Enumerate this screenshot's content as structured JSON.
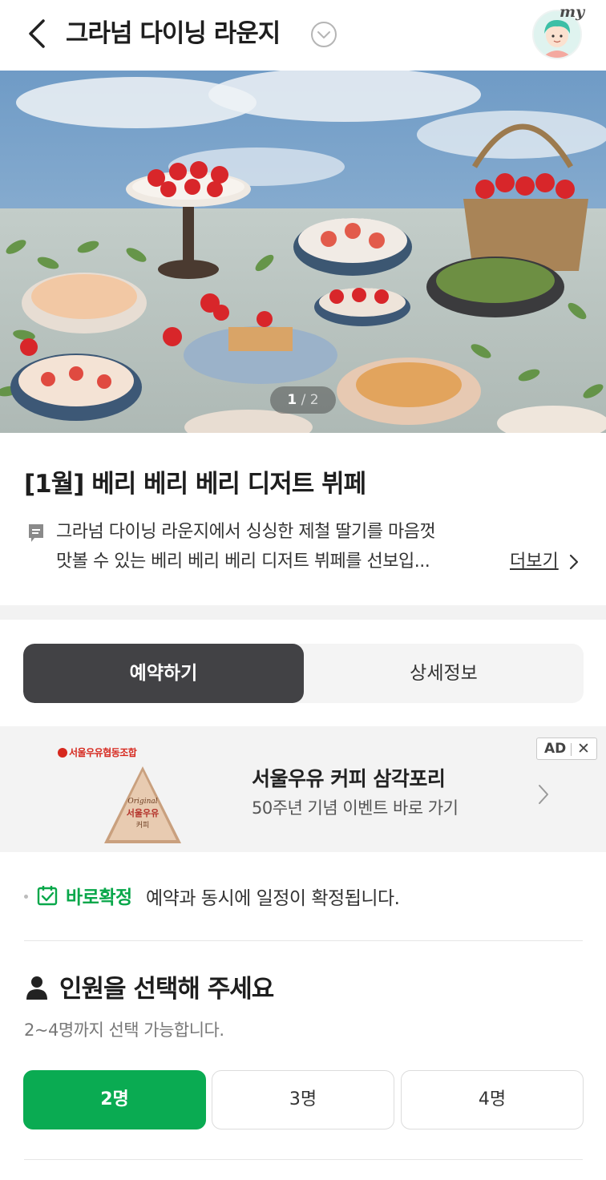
{
  "header": {
    "title": "그라넘 다이닝 라운지",
    "avatar_label": "my"
  },
  "hero": {
    "page_current": "1",
    "page_separator": "/",
    "page_total": "2"
  },
  "product": {
    "title": "[1월] 베리 베리 베리 디저트 뷔페",
    "description_line1": "그라넘 다이닝 라운지에서 싱싱한 제철 딸기를 마음껏",
    "description_line2": "맛볼 수 있는 베리 베리 베리 디저트 뷔페를 선보입...",
    "more_label": "더보기"
  },
  "tabs": [
    {
      "label": "예약하기",
      "active": true
    },
    {
      "label": "상세정보",
      "active": false
    }
  ],
  "ad": {
    "brand": "서울우유협동조합",
    "title": "서울우유 커피 삼각포리",
    "subtitle": "50주년 기념 이벤트 바로 가기",
    "badge": "AD",
    "close": "✕",
    "package_top": "Original",
    "package_name": "서울우유",
    "package_sub": "커피"
  },
  "instant_confirm": {
    "label": "바로확정",
    "text": "예약과 동시에 일정이 확정됩니다."
  },
  "people": {
    "heading": "인원을 선택해 주세요",
    "hint": "2~4명까지 선택 가능합니다.",
    "options": [
      {
        "label": "2명",
        "selected": true
      },
      {
        "label": "3명",
        "selected": false
      },
      {
        "label": "4명",
        "selected": false
      }
    ]
  },
  "colors": {
    "accent_green": "#0aab52",
    "confirm_green": "#08a74a",
    "active_tab": "#424245",
    "brand_red": "#d6281e"
  }
}
